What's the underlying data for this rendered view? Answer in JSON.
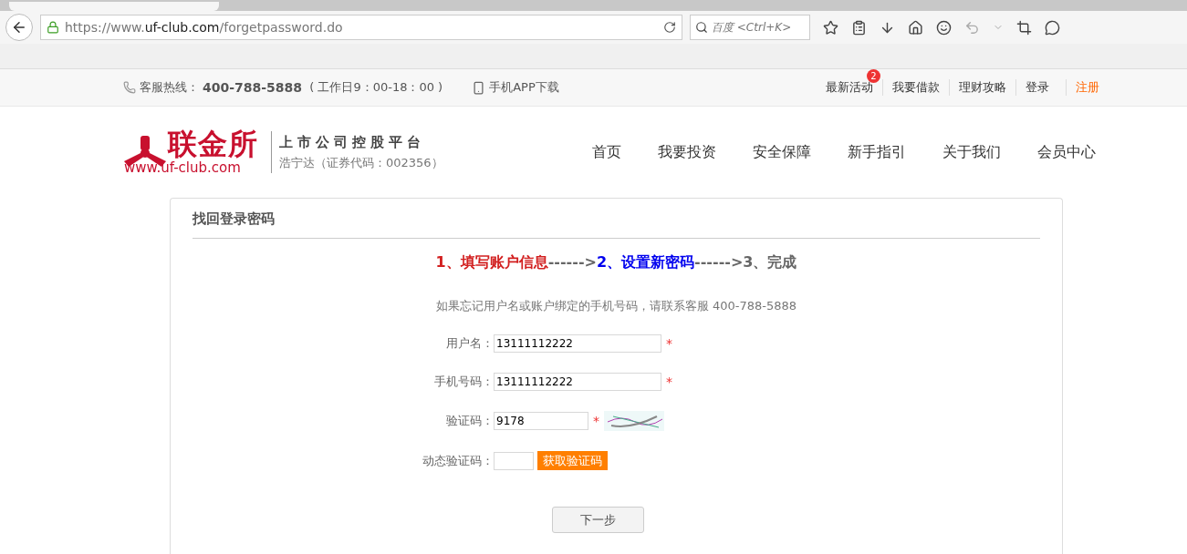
{
  "browser": {
    "url_prefix": "https://www.",
    "url_domain": "uf-club.com",
    "url_path": "/forgetpassword.do",
    "search_placeholder": "百度 <Ctrl+K>"
  },
  "topbar": {
    "hotline_label": "客服热线：",
    "hotline": "400-788-5888",
    "hours": "( 工作日9：00-18：00 )",
    "app_download": "手机APP下载",
    "links": [
      {
        "label": "最新活动",
        "badge": "2",
        "kind": "normal"
      },
      {
        "label": "我要借款",
        "kind": "normal"
      },
      {
        "label": "理财攻略",
        "kind": "normal"
      },
      {
        "label": "登录",
        "kind": "normal"
      },
      {
        "label": "注册",
        "kind": "accent"
      }
    ]
  },
  "header": {
    "logo_name": "联金所",
    "logo_url": "www.uf-club.com",
    "slogan": "上市公司控股平台",
    "stock": "浩宁达（证券代码：002356）",
    "nav": [
      {
        "label": "首页"
      },
      {
        "label": "我要投资"
      },
      {
        "label": "安全保障"
      },
      {
        "label": "新手指引"
      },
      {
        "label": "关于我们"
      },
      {
        "label": "会员中心"
      }
    ]
  },
  "form": {
    "title": "找回登录密码",
    "steps": [
      {
        "label": "1、填写账户信息",
        "kind": "done"
      },
      {
        "label": "------>",
        "kind": "arrow"
      },
      {
        "label": "2、设置新密码",
        "kind": "current"
      },
      {
        "label": "------>",
        "kind": "arrow"
      },
      {
        "label": "3、完成",
        "kind": "pending"
      }
    ],
    "notice": "如果忘记用户名或账户绑定的手机号码，请联系客服 400-788-5888",
    "fields": [
      {
        "label": "用户名：",
        "value": "13111112222",
        "required": true,
        "kind": "text"
      },
      {
        "label": "手机号码：",
        "value": "13111112222",
        "required": true,
        "kind": "text"
      },
      {
        "label": "验证码：",
        "value": "9178",
        "required": true,
        "kind": "captcha"
      },
      {
        "label": "动态验证码：",
        "required": false,
        "kind": "sms",
        "button": "获取验证码"
      }
    ],
    "required_mark": "*",
    "submit": "下一步"
  }
}
